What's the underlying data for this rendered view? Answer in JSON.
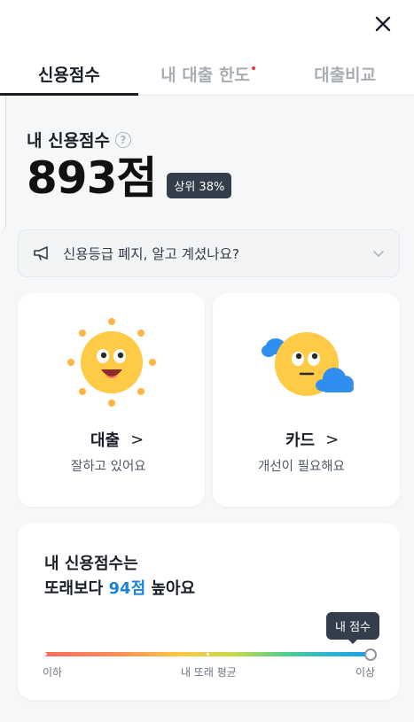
{
  "header": {
    "close_label": "✕"
  },
  "tabs": [
    {
      "label": "신용점수",
      "active": true
    },
    {
      "label": "내 대출 한도",
      "has_dot": true
    },
    {
      "label": "대출비교"
    }
  ],
  "score": {
    "label": "내 신용점수",
    "help": "?",
    "value": "893점",
    "rank": "상위 38%"
  },
  "notice": {
    "text": "신용등급 폐지, 알고 계셨나요?"
  },
  "cards": [
    {
      "title": "대출",
      "arrow": ">",
      "subtitle": "잘하고 있어요",
      "icon": "happy-sun-icon"
    },
    {
      "title": "카드",
      "arrow": ">",
      "subtitle": "개선이 필요해요",
      "icon": "cloudy-face-icon"
    }
  ],
  "compare": {
    "line1": "내 신용점수는",
    "line2_prefix": "또래보다 ",
    "line2_highlight": "94점",
    "line2_suffix": " 높아요",
    "tooltip": "내 점수",
    "bar_position": 1.0,
    "labels": {
      "low": "이하",
      "mid": "내 또래 평균",
      "high": "이상"
    }
  },
  "colors": {
    "highlight": "#1b84d9",
    "badge": "#333d4b",
    "text": "#191f28"
  }
}
